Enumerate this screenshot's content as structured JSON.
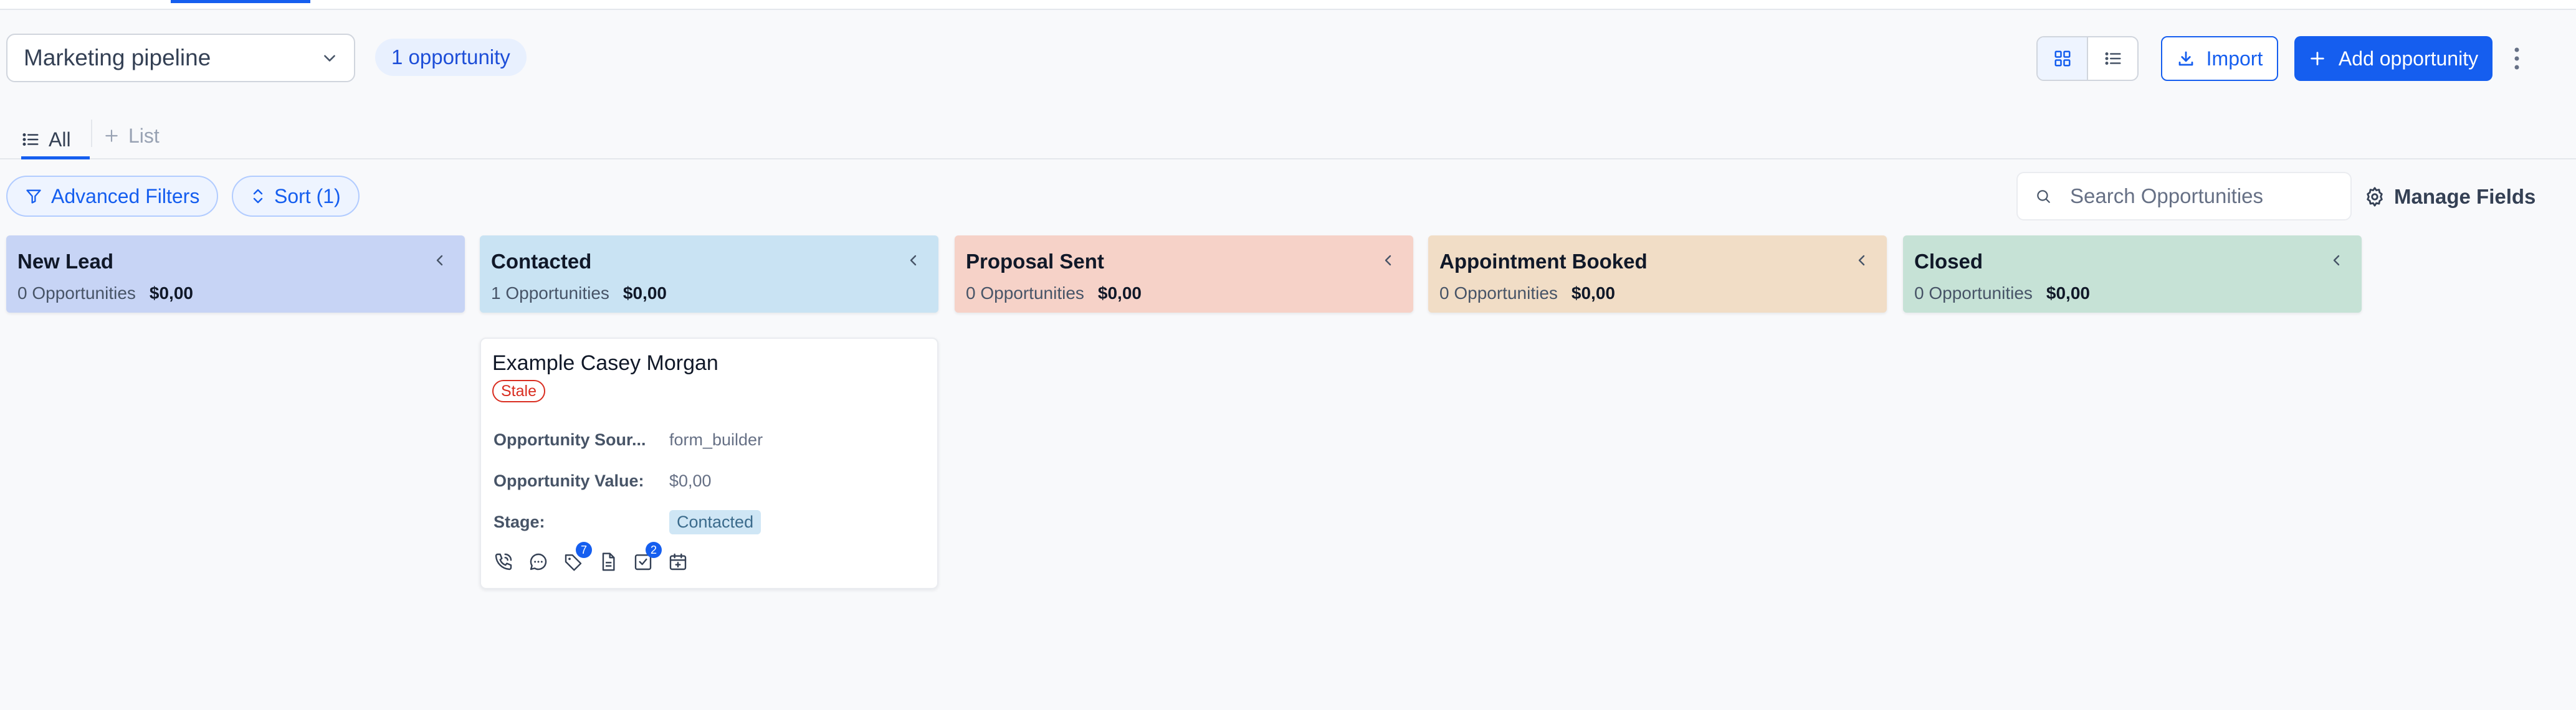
{
  "header": {
    "pipeline_value": "Marketing pipeline",
    "opportunity_count": "1 opportunity",
    "import_label": "Import",
    "add_label": "Add opportunity"
  },
  "tabs": {
    "all_label": "All",
    "add_list_label": "List"
  },
  "filters": {
    "advanced_label": "Advanced Filters",
    "sort_label": "Sort (1)",
    "search_placeholder": "Search Opportunities",
    "manage_fields_label": "Manage Fields"
  },
  "columns": [
    {
      "title": "New Lead",
      "count": "0 Opportunities",
      "amount": "$0,00",
      "color": "#c7d4f5"
    },
    {
      "title": "Contacted",
      "count": "1 Opportunities",
      "amount": "$0,00",
      "color": "#c9e3f3"
    },
    {
      "title": "Proposal Sent",
      "count": "0 Opportunities",
      "amount": "$0,00",
      "color": "#f6d2c8"
    },
    {
      "title": "Appointment Booked",
      "count": "0 Opportunities",
      "amount": "$0,00",
      "color": "#f1ddc6"
    },
    {
      "title": "Closed",
      "count": "0 Opportunities",
      "amount": "$0,00",
      "color": "#c6e2d6"
    }
  ],
  "card": {
    "name": "Example Casey Morgan",
    "stale_label": "Stale",
    "fields": [
      {
        "label": "Opportunity Sour...",
        "value": "form_builder"
      },
      {
        "label": "Opportunity Value:",
        "value": "$0,00"
      },
      {
        "label": "Stage:",
        "value": "Contacted"
      }
    ],
    "icons": [
      "phone-icon",
      "chat-icon",
      "tag-icon",
      "document-icon",
      "task-icon",
      "calendar-icon"
    ],
    "tag_badge": "7",
    "task_badge": "2"
  },
  "colors": {
    "accent": "#155eef",
    "stale": "#d92d20"
  }
}
